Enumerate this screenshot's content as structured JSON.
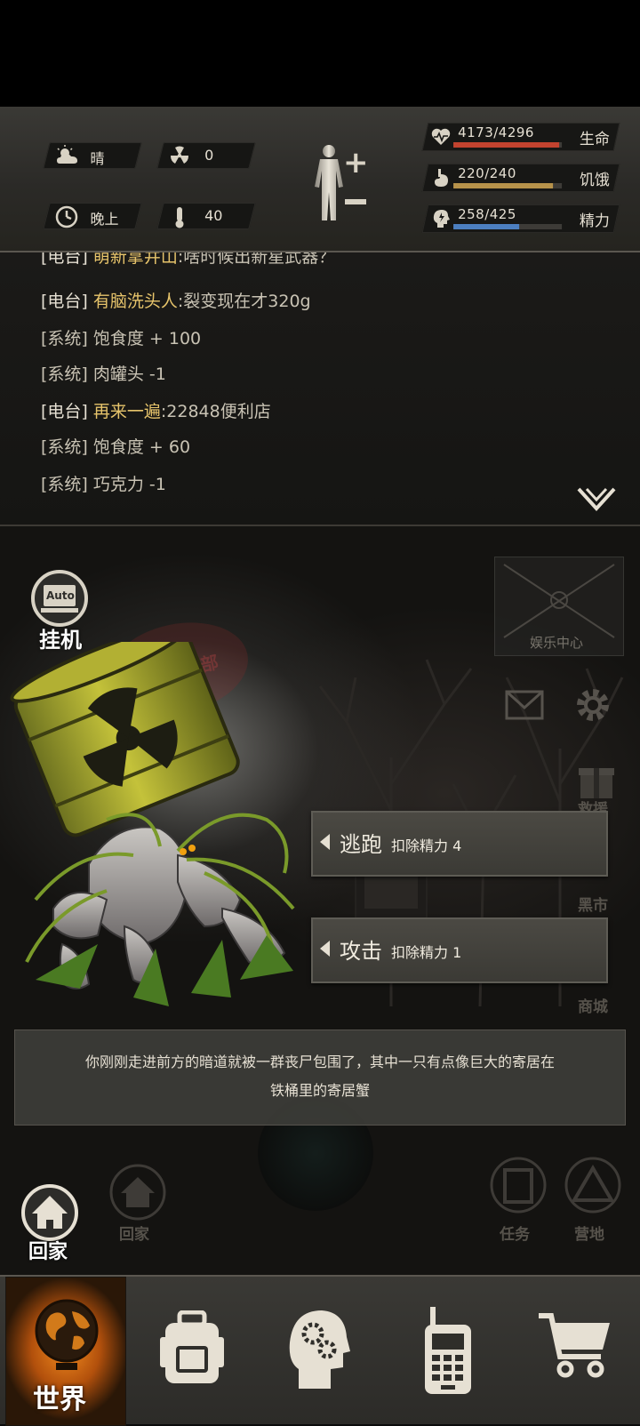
{
  "hud": {
    "weather": "晴",
    "radiation": "0",
    "time_of_day": "晚上",
    "temperature": "40",
    "health": {
      "label": "生命",
      "text": "4173/4296",
      "current": 4173,
      "max": 4296,
      "color": "#c2432f"
    },
    "hunger": {
      "label": "饥饿",
      "text": "220/240",
      "current": 220,
      "max": 240,
      "color": "#b7924a"
    },
    "energy": {
      "label": "精力",
      "text": "258/425",
      "current": 258,
      "max": 425,
      "color": "#4c7fc0"
    }
  },
  "log": {
    "messages": [
      {
        "tag": "[电台]",
        "name": "萌新拿井山",
        "text": ":啥时候出新星武器？",
        "type": "radio"
      },
      {
        "tag": "[电台]",
        "name": "有脑洗头人",
        "text": ":裂变现在才320g",
        "type": "radio"
      },
      {
        "tag": "[系统]",
        "name": "",
        "text": "饱食度 + 100",
        "type": "system"
      },
      {
        "tag": "[系统]",
        "name": "",
        "text": "肉罐头 -1",
        "type": "system"
      },
      {
        "tag": "[电台]",
        "name": "再来一遍",
        "text": ":22848便利店",
        "type": "radio"
      },
      {
        "tag": "[系统]",
        "name": "",
        "text": "饱食度 + 60",
        "type": "system"
      },
      {
        "tag": "[系统]",
        "name": "",
        "text": "巧克力 -1",
        "type": "system"
      }
    ]
  },
  "scene": {
    "auto_label": "挂机",
    "auto_badge": "Auto",
    "entertainment_label": "娱乐中心",
    "club_sign": "乡村俱乐部",
    "black_market_label": "黑市",
    "shop_label": "商城",
    "rescue_label": "救援",
    "home_faded_label": "回家",
    "task_label": "任务",
    "camp_label": "营地",
    "actions": [
      {
        "name": "逃跑",
        "cost": "扣除精力 4"
      },
      {
        "name": "攻击",
        "cost": "扣除精力 1"
      }
    ],
    "narration_line1": "你刚刚走进前方的暗道就被一群丧尸包围了，其中一只有点像巨大的寄居在",
    "narration_line2": "铁桶里的寄居蟹",
    "home_label": "回家",
    "enemy": "radioactive-barrel-hermit-crab"
  },
  "tabs": {
    "world": "世界",
    "items": [
      "backpack",
      "skills",
      "radio",
      "shop"
    ]
  }
}
